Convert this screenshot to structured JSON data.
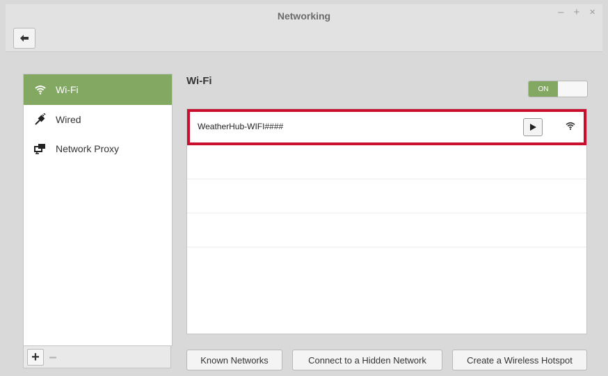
{
  "window": {
    "title": "Networking",
    "controls": [
      "–",
      "+",
      "×"
    ]
  },
  "sidebar": {
    "items": [
      {
        "label": "Wi-Fi",
        "icon": "wifi-icon",
        "active": true
      },
      {
        "label": "Wired",
        "icon": "wired-plug-icon",
        "active": false
      },
      {
        "label": "Network Proxy",
        "icon": "network-proxy-icon",
        "active": false
      }
    ],
    "toolbar": {
      "add_label": "+",
      "remove_label": "–"
    }
  },
  "main": {
    "heading": "Wi-Fi",
    "toggle": {
      "label": "ON",
      "state": true
    },
    "networks": [
      {
        "ssid": "WeatherHub-WIFI####",
        "highlighted": true
      }
    ]
  },
  "buttons": {
    "known_networks": "Known Networks",
    "hidden_network": "Connect to a Hidden Network",
    "hotspot": "Create a Wireless Hotspot"
  },
  "colors": {
    "accent": "#82a861",
    "highlight": "#c8102e",
    "background": "#d9d9d9"
  }
}
